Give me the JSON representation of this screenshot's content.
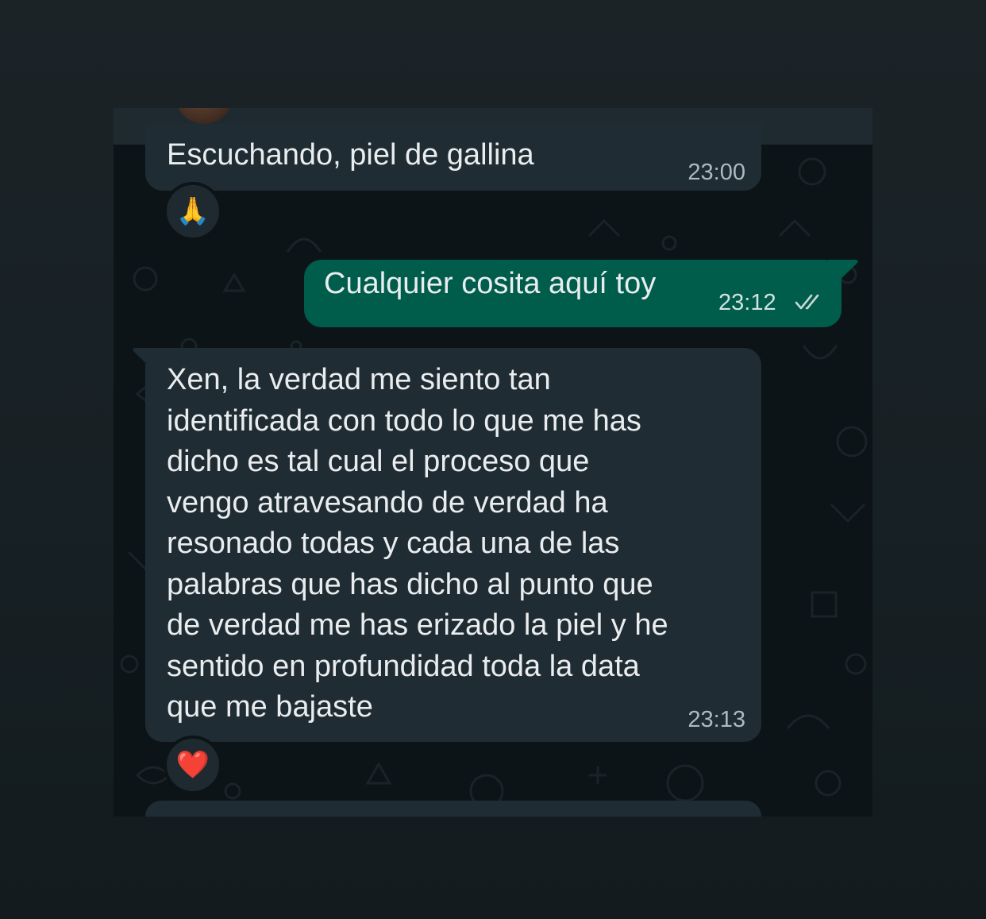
{
  "colors": {
    "incoming_bubble": "#202c33",
    "outgoing_bubble": "#005c4b",
    "chat_background": "#0d1418",
    "timestamp": "#aebac1"
  },
  "messages": [
    {
      "direction": "incoming",
      "text": "Escuchando, piel de gallina",
      "time": "23:00",
      "reaction": "🙏",
      "reaction_icon": "folded-hands-emoji"
    },
    {
      "direction": "outgoing",
      "text": "Cualquier cosita aquí toy",
      "time": "23:12",
      "status_icon": "double-check-icon"
    },
    {
      "direction": "incoming",
      "lines": [
        "Xen, la verdad me siento tan",
        "identificada con todo lo que me has",
        "dicho es tal cual el proceso que",
        "vengo atravesando de verdad ha",
        "resonado todas y cada una de las",
        "palabras que has dicho al punto que",
        "de verdad me has erizado la piel y he",
        "sentido en profundidad toda la data",
        "que me bajaste"
      ],
      "time": "23:13",
      "reaction": "❤️",
      "reaction_icon": "red-heart-emoji"
    }
  ]
}
